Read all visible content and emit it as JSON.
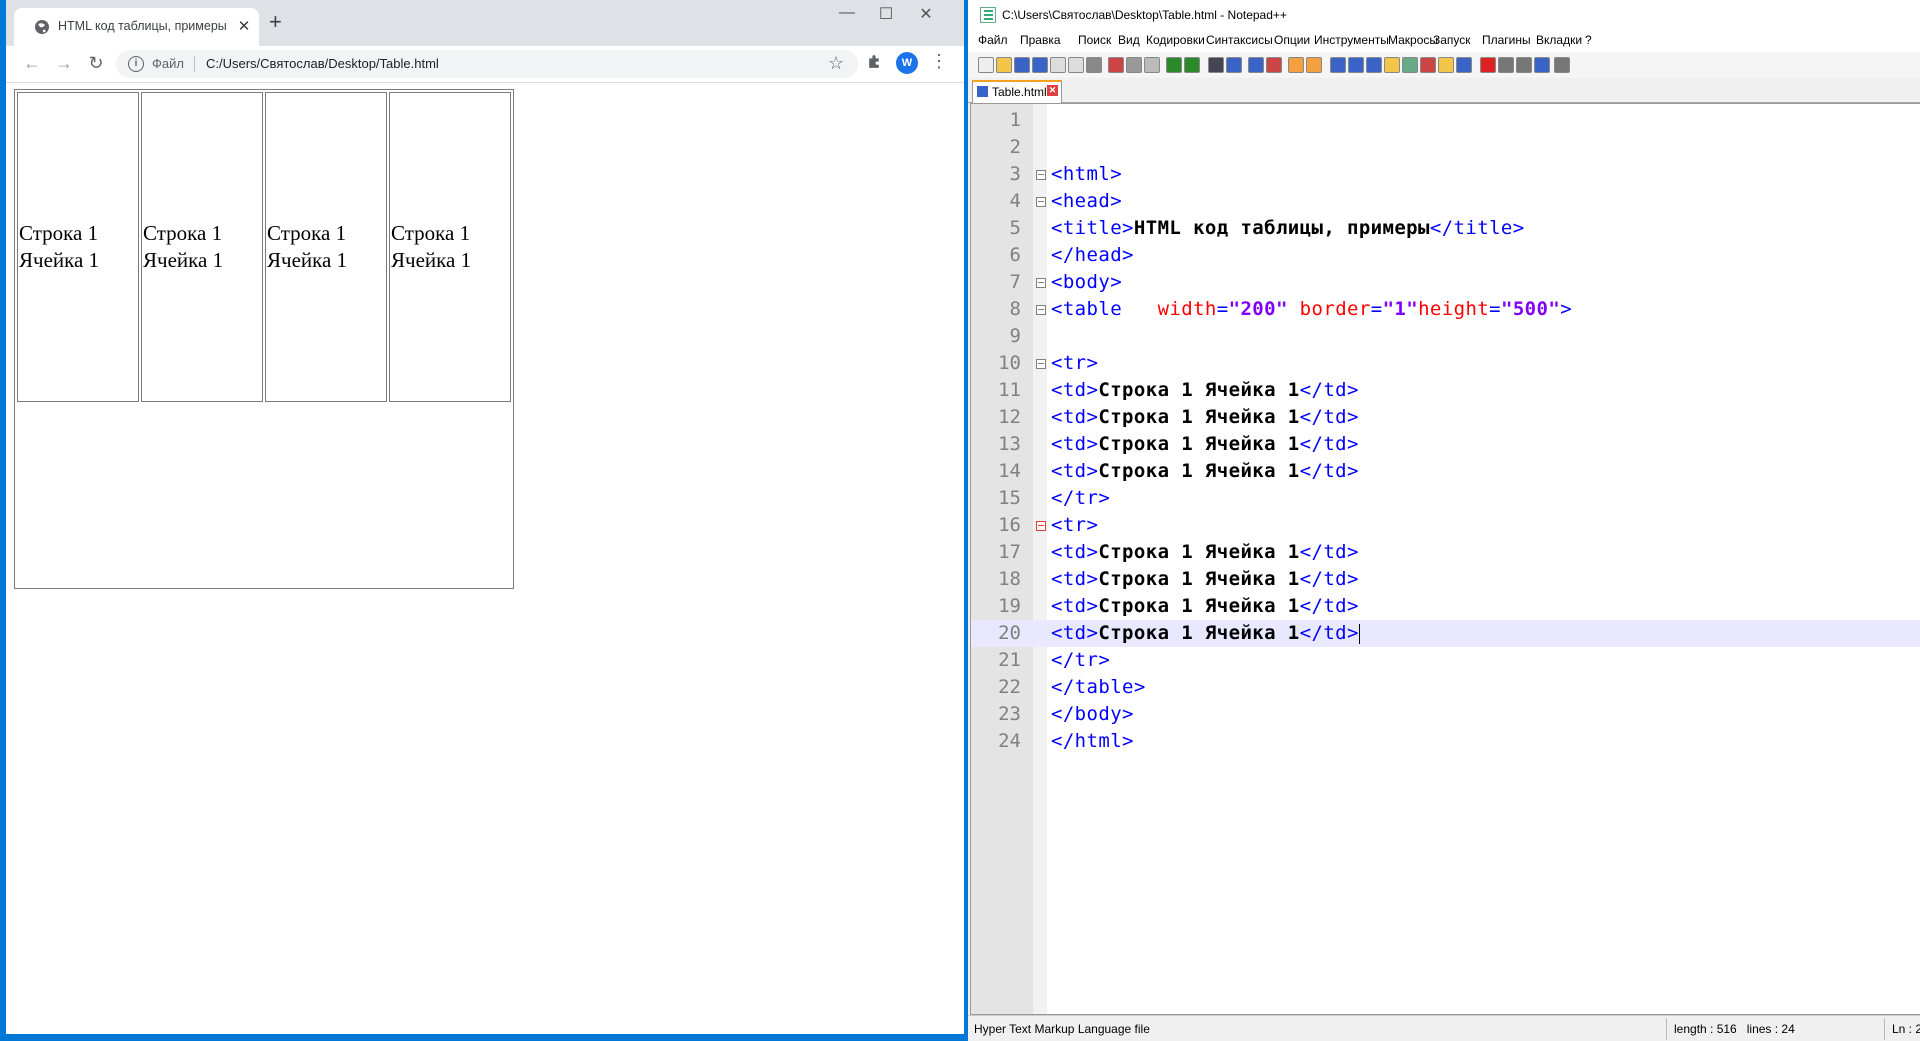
{
  "browser": {
    "tab_title": "HTML код таблицы, примеры",
    "tab_close": "✕",
    "new_tab": "+",
    "window_controls": [
      "—",
      "☐",
      "✕"
    ],
    "nav": {
      "back": "←",
      "forward": "→",
      "reload": "↻"
    },
    "omnibox": {
      "file_label": "Файл",
      "url": "C:/Users/Святослав/Desktop/Table.html"
    },
    "avatar_letter": "W",
    "page": {
      "rows": [
        [
          "Строка 1 Ячейка 1",
          "Строка 1 Ячейка 1",
          "Строка 1 Ячейка 1",
          "Строка 1 Ячейка 1"
        ]
      ]
    }
  },
  "notepad": {
    "title": "C:\\Users\\Святослав\\Desktop\\Table.html - Notepad++",
    "menu": [
      "Файл",
      "Правка",
      "Поиск",
      "Вид",
      "Кодировки",
      "Синтаксисы",
      "Опции",
      "Инструменты",
      "Макросы",
      "Запуск",
      "Плагины",
      "Вкладки",
      "?"
    ],
    "file_tab": "Table.html",
    "status": {
      "language": "Hyper Text Markup Language file",
      "length": "length : 516",
      "lines": "lines : 24",
      "position": "Ln : 2"
    },
    "code_lines": [
      "",
      "",
      "<html>",
      "<head>",
      "<title>HTML код таблицы, примеры</title>",
      "</head>",
      "<body>",
      "<table   width=\"200\" border=\"1\"height=\"500\">",
      "",
      "<tr>",
      "<td>Строка 1 Ячейка 1</td>",
      "<td>Строка 1 Ячейка 1</td>",
      "<td>Строка 1 Ячейка 1</td>",
      "<td>Строка 1 Ячейка 1</td>",
      "</tr>",
      "<tr>",
      "<td>Строка 1 Ячейка 1</td>",
      "<td>Строка 1 Ячейка 1</td>",
      "<td>Строка 1 Ячейка 1</td>",
      "<td>Строка 1 Ячейка 1</td>",
      "</tr>",
      "</table>",
      "</body>",
      "</html>"
    ],
    "current_line": 20,
    "colors": {
      "tag": "#0000ff",
      "attr": "#ff0000",
      "value": "#8000ff",
      "text": "#000000",
      "line_highlight": "#e8e8ff"
    }
  }
}
